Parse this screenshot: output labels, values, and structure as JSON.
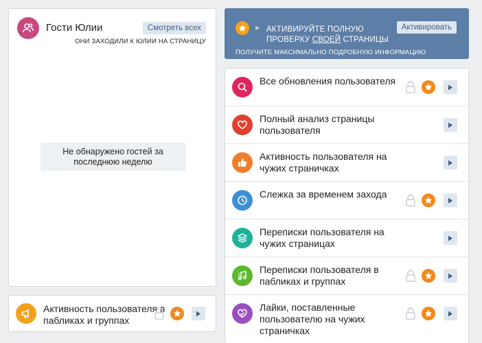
{
  "guests": {
    "title": "Гости Юлии",
    "see_all_label": "Смотреть всех",
    "subtitle": "ОНИ ЗАХОДИЛИ К ЮЛИИ НА СТРАНИЦУ",
    "empty_message": "Не обнаружено гостей за последнюю неделю",
    "avatar_color": "#c8487e"
  },
  "promo": {
    "title_part1": "АКТИВИРУЙТЕ ПОЛНУЮ",
    "title_part2": "ПРОВЕРКУ",
    "title_link": "СВОЕЙ",
    "title_part3": "СТРАНИЦЫ",
    "activate_label": "Активировать",
    "subtitle": "ПОЛУЧИТЕ МАКСИМАЛЬНО ПОДРОБНУЮ ИНФОРМАЦИЮ",
    "background_color": "#5d7ea6"
  },
  "groups_activity": {
    "label": "Активность пользователя в пабликах и группах",
    "icon": "megaphone-icon",
    "color": "#f0a21c",
    "locked": true,
    "premium": true
  },
  "features": [
    {
      "label": "Все обновления пользователя",
      "icon": "search-icon",
      "color": "#e0245e",
      "locked": true,
      "premium": true
    },
    {
      "label": "Полный анализ страницы пользователя",
      "icon": "heart-icon",
      "color": "#e0402f",
      "locked": false,
      "premium": false
    },
    {
      "label": "Активность пользователя на чужих страничках",
      "icon": "thumbs-up-icon",
      "color": "#f07d2a",
      "locked": false,
      "premium": false
    },
    {
      "label": "Слежка за временем захода",
      "icon": "clock-icon",
      "color": "#3d8fd6",
      "locked": true,
      "premium": true
    },
    {
      "label": "Переписки пользователя на чужих страницах",
      "icon": "layers-icon",
      "color": "#1fb29a",
      "locked": false,
      "premium": false
    },
    {
      "label": "Переписки пользователя в пабликах и группах",
      "icon": "music-note-icon",
      "color": "#5cb82e",
      "locked": true,
      "premium": true
    },
    {
      "label": "Лайки, поставленные пользователю на чужих страничках",
      "icon": "heart-icon",
      "color": "#9b4fbf",
      "locked": true,
      "premium": true
    }
  ]
}
